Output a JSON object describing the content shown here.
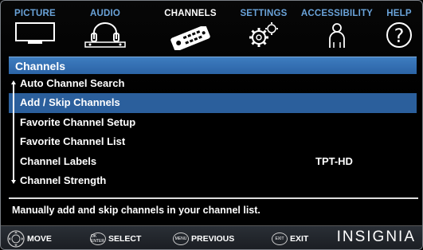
{
  "tabs": [
    {
      "label": "PICTURE",
      "icon": "tv-icon"
    },
    {
      "label": "AUDIO",
      "icon": "headphones-icon"
    },
    {
      "label": "CHANNELS",
      "icon": "remote-icon",
      "active": true
    },
    {
      "label": "SETTINGS",
      "icon": "gears-icon"
    },
    {
      "label": "ACCESSIBILITY",
      "icon": "person-icon"
    },
    {
      "label": "HELP",
      "icon": "question-icon"
    }
  ],
  "menu": {
    "title": "Channels",
    "items": [
      {
        "label": "Auto Channel Search",
        "value": ""
      },
      {
        "label": "Add / Skip Channels",
        "value": "",
        "selected": true
      },
      {
        "label": "Favorite Channel Setup",
        "value": ""
      },
      {
        "label": "Favorite Channel List",
        "value": ""
      },
      {
        "label": "Channel Labels",
        "value": "TPT-HD"
      },
      {
        "label": "Channel Strength",
        "value": ""
      }
    ]
  },
  "help_text": "Manually add and skip channels in your channel list.",
  "footer": {
    "move": "MOVE",
    "ok_icon": "OK ENTER",
    "select": "SELECT",
    "menu_icon": "MENU",
    "previous": "PREVIOUS",
    "exit_icon": "EXIT",
    "exit": "EXIT",
    "brand": "INSIGNIA"
  },
  "colors": {
    "accent": "#2b5f9c",
    "tab_label": "#6aa3d9"
  }
}
